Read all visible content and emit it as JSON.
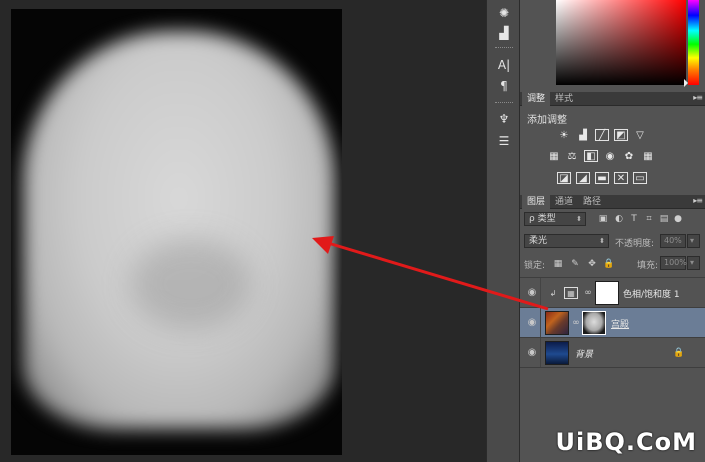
{
  "colors": {
    "canvas_bg": "#282828",
    "panel_bg": "#535353",
    "selected_layer": "#6b7d96",
    "arrow": "#e11a1a"
  },
  "adjustments": {
    "tabs": [
      {
        "label": "调整"
      },
      {
        "label": "样式"
      }
    ],
    "title": "添加调整"
  },
  "layers": {
    "tabs": [
      {
        "label": "图层"
      },
      {
        "label": "通道"
      },
      {
        "label": "路径"
      }
    ],
    "filter_kind": "ρ 类型",
    "blend_mode": "柔光",
    "opacity_label": "不透明度:",
    "opacity_value": "40%",
    "lock_label": "锁定:",
    "fill_label": "填充:",
    "fill_value": "100%",
    "items": [
      {
        "name": "色相/饱和度 1",
        "type": "adjustment"
      },
      {
        "name": "宫殿",
        "type": "image-with-mask",
        "selected": true
      },
      {
        "name": "背景",
        "type": "background",
        "locked": true
      }
    ]
  },
  "watermark": "UiBQ.CoM"
}
